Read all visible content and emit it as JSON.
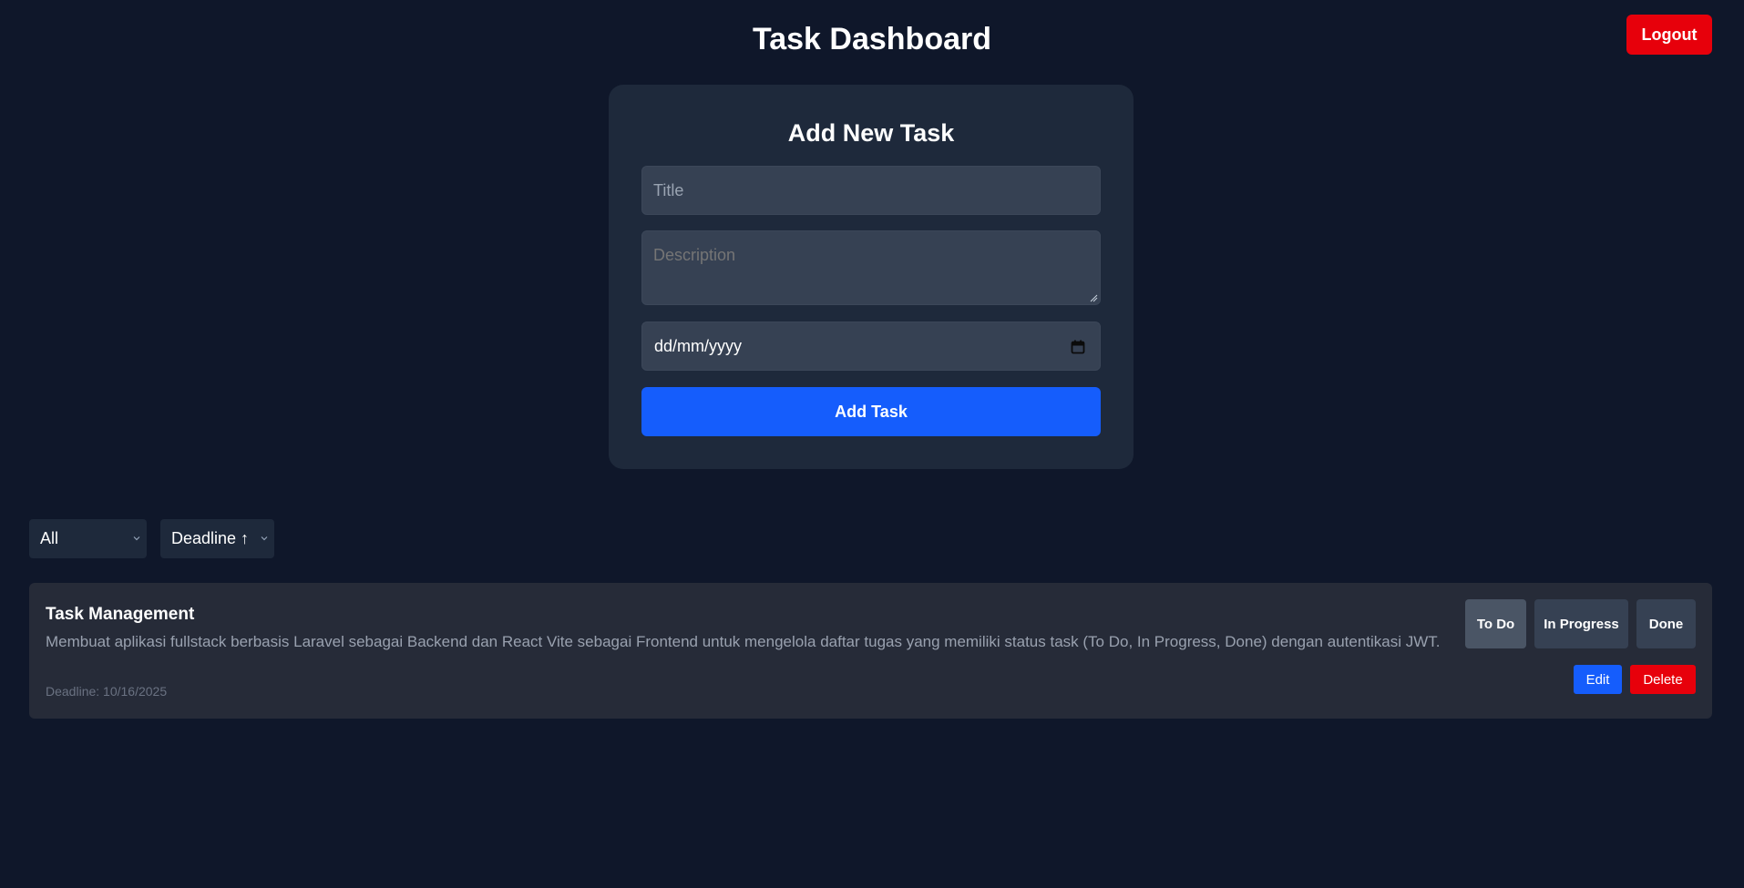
{
  "header": {
    "title": "Task Dashboard",
    "logout_label": "Logout"
  },
  "form": {
    "heading": "Add New Task",
    "title_placeholder": "Title",
    "title_value": "",
    "description_placeholder": "Description",
    "description_value": "",
    "date_placeholder": "dd/mm/yyyy",
    "date_icon": "calendar-icon",
    "submit_label": "Add Task"
  },
  "filters": {
    "status_selected": "All",
    "sort_selected": "Deadline ↑",
    "chevron_icon": "chevron-down-icon"
  },
  "tasks": [
    {
      "title": "Task Management",
      "description": "Membuat aplikasi fullstack berbasis Laravel sebagai Backend dan React Vite sebagai Frontend untuk mengelola daftar tugas yang memiliki status task (To Do, In Progress, Done) dengan autentikasi JWT.",
      "deadline": "Deadline: 10/16/2025",
      "status_buttons": [
        "To Do",
        "In Progress",
        "Done"
      ],
      "active_status": "To Do",
      "edit_label": "Edit",
      "delete_label": "Delete"
    }
  ],
  "colors": {
    "background": "#0f172a",
    "card": "#1e293b",
    "input": "#364153",
    "primary": "#155dfc",
    "danger": "#e7000b",
    "task_card": "#262b38"
  }
}
